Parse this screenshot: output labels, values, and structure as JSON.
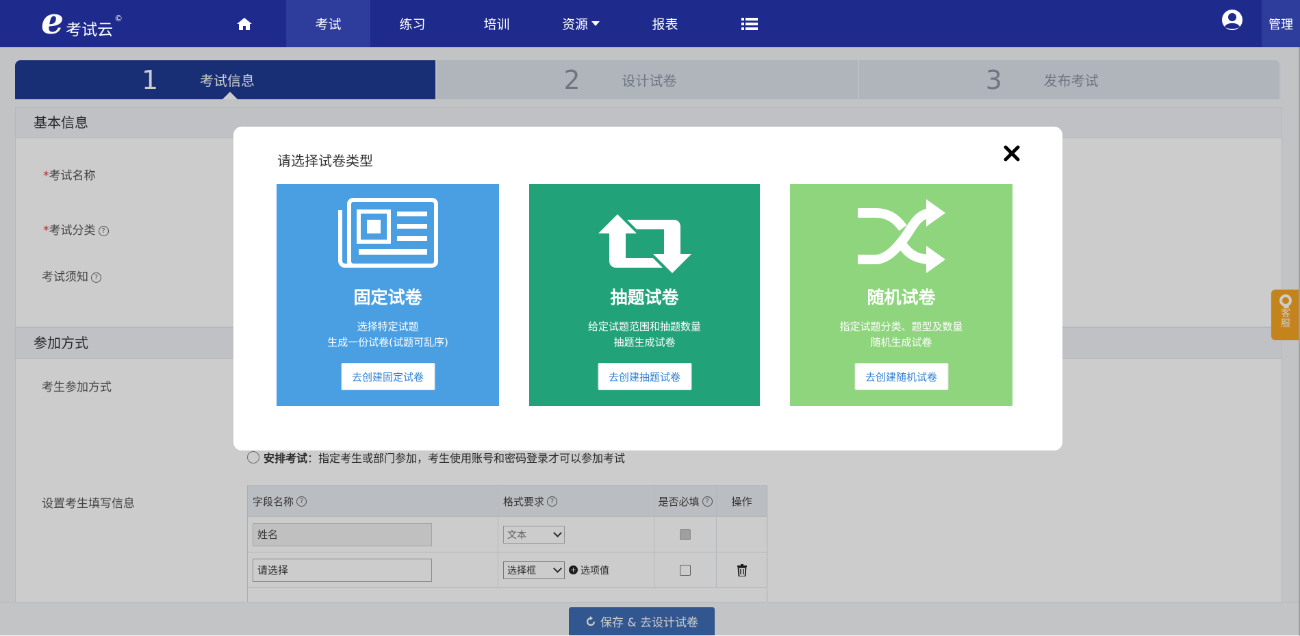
{
  "header": {
    "logo_letter": "e",
    "logo_text": "考试云",
    "logo_mark": "©",
    "nav": [
      {
        "label": "",
        "icon": "home-icon"
      },
      {
        "label": "考试"
      },
      {
        "label": "练习"
      },
      {
        "label": "培训"
      },
      {
        "label": "资源"
      },
      {
        "label": "报表"
      },
      {
        "label": "",
        "icon": "list-icon"
      }
    ],
    "manage_label": "管理"
  },
  "steps": [
    {
      "num": "1",
      "label": "考试信息"
    },
    {
      "num": "2",
      "label": "设计试卷"
    },
    {
      "num": "3",
      "label": "发布考试"
    }
  ],
  "basic_info": {
    "title": "基本信息",
    "exam_name_label": "考试名称",
    "exam_category_label": "考试分类",
    "exam_notice_label": "考试须知"
  },
  "join": {
    "title": "参加方式",
    "mode_label": "考生参加方式",
    "arrange_bold": "安排考试",
    "arrange_desc": "：指定考生或部门参加，考生使用账号和密码登录才可以参加考试",
    "fill_info_label": "设置考生填写信息"
  },
  "fields_table": {
    "headers": [
      "字段名称",
      "格式要求",
      "是否必填",
      "操作"
    ],
    "rows": [
      {
        "name": "姓名",
        "format": "文本",
        "required": true
      },
      {
        "name": "请选择",
        "format": "选择框",
        "option_link": "选项值",
        "required": false
      }
    ]
  },
  "footer": {
    "save_label": "保存 & 去设计试卷"
  },
  "side_service": {
    "line1": "客",
    "line2": "服"
  },
  "modal": {
    "title": "请选择试卷类型",
    "cards": [
      {
        "title": "固定试卷",
        "desc1": "选择特定试题",
        "desc2": "生成一份试卷(试题可乱序)",
        "button": "去创建固定试卷",
        "color": "#4a9fe3"
      },
      {
        "title": "抽题试卷",
        "desc1": "给定试题范围和抽题数量",
        "desc2": "抽题生成试卷",
        "button": "去创建抽题试卷",
        "color": "#21a279"
      },
      {
        "title": "随机试卷",
        "desc1": "指定试题分类、题型及数量",
        "desc2": "随机生成试卷",
        "button": "去创建随机试卷",
        "color": "#8fd57e"
      }
    ]
  }
}
